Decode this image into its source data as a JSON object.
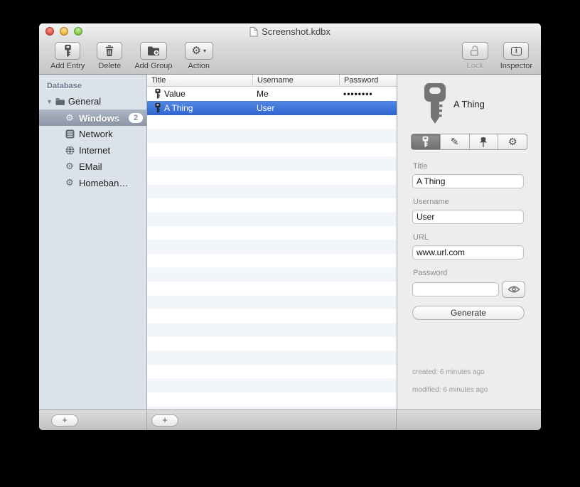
{
  "window": {
    "title": "Screenshot.kdbx"
  },
  "toolbar": {
    "add_entry": "Add Entry",
    "delete": "Delete",
    "add_group": "Add Group",
    "action": "Action",
    "lock": "Lock",
    "inspector": "Inspector"
  },
  "sidebar": {
    "header": "Database",
    "root_label": "General",
    "items": [
      {
        "label": "Windows",
        "icon": "gear",
        "badge": "2",
        "selected": true
      },
      {
        "label": "Network",
        "icon": "network",
        "selected": false
      },
      {
        "label": "Internet",
        "icon": "globe",
        "selected": false
      },
      {
        "label": "EMail",
        "icon": "gear",
        "selected": false
      },
      {
        "label": "Homeban…",
        "icon": "gear",
        "selected": false
      }
    ]
  },
  "table": {
    "columns": [
      "Title",
      "Username",
      "Password"
    ],
    "rows": [
      {
        "title": "Value",
        "username": "Me",
        "password": "••••••••",
        "selected": false
      },
      {
        "title": "A Thing",
        "username": "User",
        "password": "",
        "selected": true
      }
    ]
  },
  "inspector": {
    "entry_title": "A Thing",
    "fields": [
      {
        "label": "Title",
        "value": "A Thing"
      },
      {
        "label": "Username",
        "value": "User"
      },
      {
        "label": "URL",
        "value": "www.url.com"
      },
      {
        "label": "Password",
        "value": ""
      }
    ],
    "generate_label": "Generate",
    "created": "created: 6 minutes ago",
    "modified": "modified: 6 minutes ago"
  },
  "bottom": {
    "add_group_plus": "+",
    "add_entry_plus": "+"
  },
  "icons": {
    "gear": "⚙",
    "pencil": "✎",
    "caret_down": "▾",
    "disclosure_down": "▼"
  },
  "colors": {
    "selection_blue": "#3a76d8",
    "sidebar_selection_gray": "#99a3b2",
    "sidebar_bg": "#dce2ea",
    "row_stripe": "#f2f6fb",
    "inspector_bg": "#ededee"
  }
}
